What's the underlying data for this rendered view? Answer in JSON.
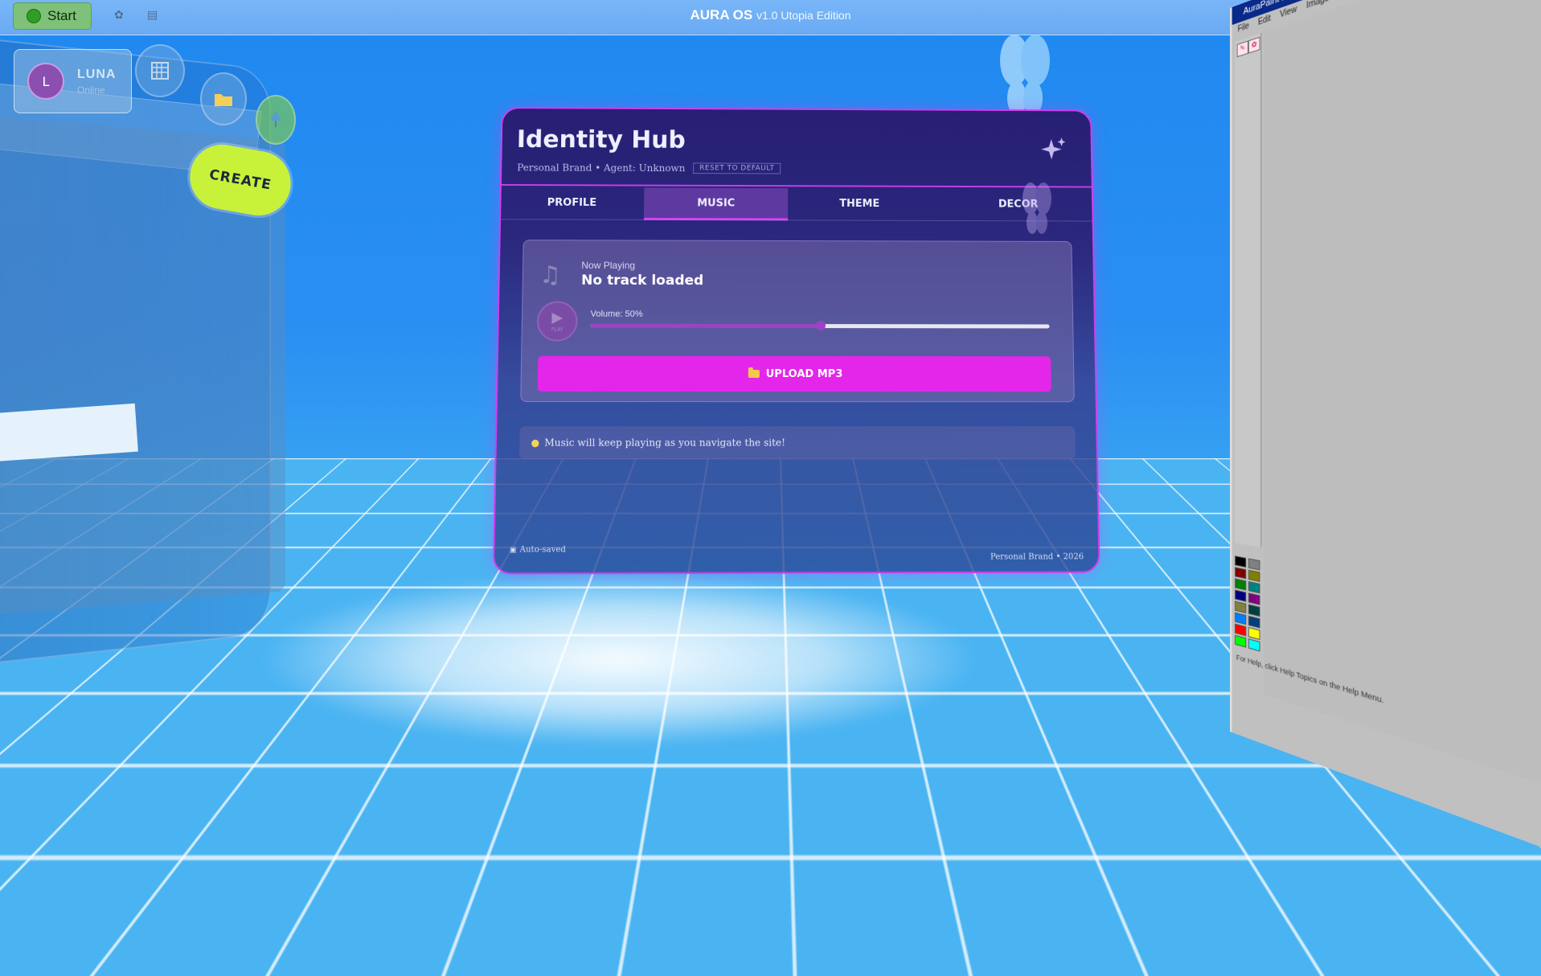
{
  "topbar": {
    "start_label": "Start",
    "os_title": "AURA OS",
    "os_version": "v1.0 Utopia Edition"
  },
  "user": {
    "initial": "L",
    "name": "LUNA",
    "status": "Online"
  },
  "dock": {
    "create_label": "CREATE"
  },
  "hub": {
    "title": "Identity Hub",
    "subtitle": "Personal Brand • Agent: Unknown",
    "reset_label": "RESET TO DEFAULT",
    "tabs": [
      {
        "label": "PROFILE",
        "active": false
      },
      {
        "label": "MUSIC",
        "active": true
      },
      {
        "label": "THEME",
        "active": false
      },
      {
        "label": "DECOR",
        "active": false
      }
    ],
    "music": {
      "now_playing_label": "Now Playing",
      "track": "No track loaded",
      "play_label": "PLAY",
      "volume_label": "Volume: 50%",
      "volume_percent": 50,
      "upload_label": "UPLOAD MP3"
    },
    "tip": "Music will keep playing as you navigate the site!",
    "autosave": "Auto-saved",
    "footer": "Personal Brand • 2026"
  },
  "paint": {
    "title": "AuraPaint Browser",
    "menu": [
      "File",
      "Edit",
      "View",
      "Image"
    ],
    "status": "For Help, click Help Topics on the Help Menu.",
    "palette": [
      "#000000",
      "#808080",
      "#800000",
      "#808000",
      "#008000",
      "#008080",
      "#000080",
      "#800080",
      "#808040",
      "#004040",
      "#0080ff",
      "#004080",
      "#ff0000",
      "#ffff00",
      "#00ff00",
      "#00ffff"
    ]
  },
  "colors": {
    "accent": "#d13df0",
    "upload": "#e326ea",
    "create": "#c8f23a",
    "start": "#7fc178"
  }
}
